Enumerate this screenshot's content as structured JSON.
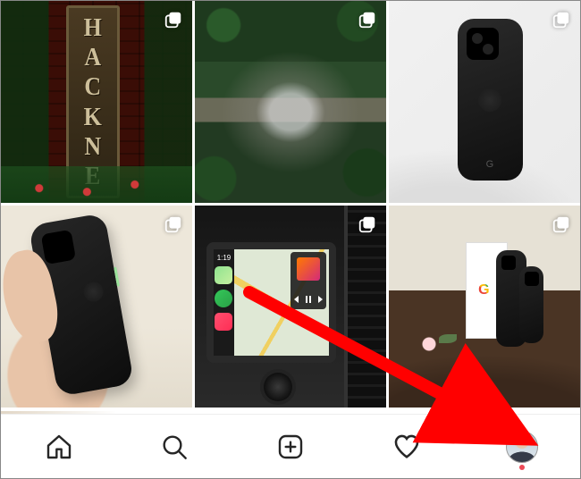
{
  "app": "Instagram",
  "grid": {
    "posts": [
      {
        "desc": "sign-on-brick-wall",
        "sign_letters": [
          "H",
          "A",
          "C",
          "K",
          "N",
          "E"
        ],
        "carousel": true
      },
      {
        "desc": "forest-stream",
        "carousel": true
      },
      {
        "desc": "black-phone-on-white-surface",
        "phone_brand_mark": "G",
        "carousel": true
      },
      {
        "desc": "black-phone-held-in-hand",
        "carousel": true
      },
      {
        "desc": "car-infotainment-carplay",
        "clock": "1:19",
        "carousel": true
      },
      {
        "desc": "two-phones-beside-box-on-table",
        "box_logo": "G",
        "carousel": true
      }
    ]
  },
  "nav": {
    "items": [
      {
        "name": "home"
      },
      {
        "name": "search"
      },
      {
        "name": "new-post"
      },
      {
        "name": "activity"
      },
      {
        "name": "profile",
        "has_notification": true
      }
    ]
  },
  "annotation": {
    "arrow_target": "profile",
    "arrow_color": "#ff0000"
  }
}
